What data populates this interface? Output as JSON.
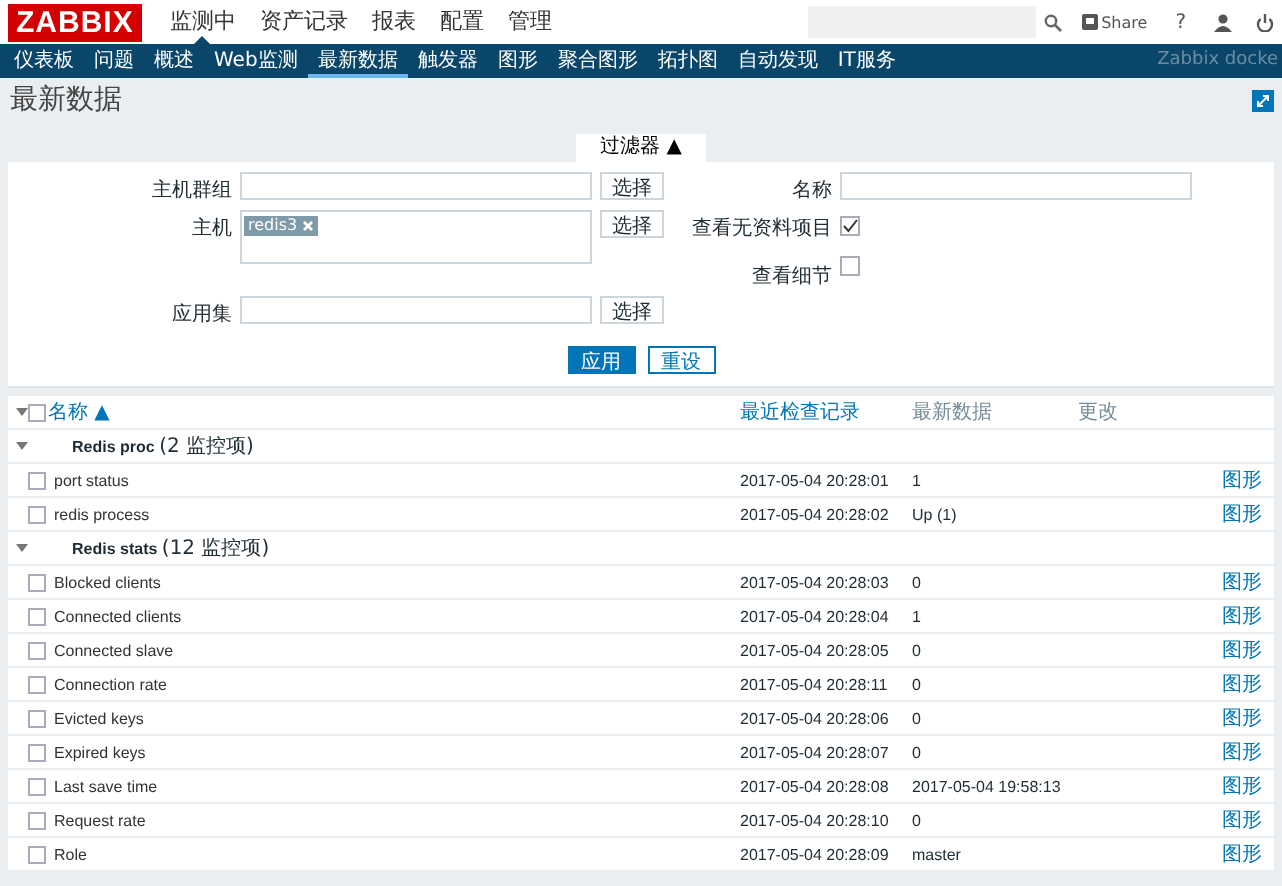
{
  "top_menu": {
    "logo": "ZABBIX",
    "items": [
      {
        "label": "监测中",
        "selected": true
      },
      {
        "label": "资产记录",
        "selected": false
      },
      {
        "label": "报表",
        "selected": false
      },
      {
        "label": "配置",
        "selected": false
      },
      {
        "label": "管理",
        "selected": false
      }
    ],
    "share": "Share",
    "help": "?"
  },
  "sub_menu": {
    "items": [
      {
        "label": "仪表板",
        "selected": false
      },
      {
        "label": "问题",
        "selected": false
      },
      {
        "label": "概述",
        "selected": false
      },
      {
        "label": "Web监测",
        "selected": false
      },
      {
        "label": "最新数据",
        "selected": true
      },
      {
        "label": "触发器",
        "selected": false
      },
      {
        "label": "图形",
        "selected": false
      },
      {
        "label": "聚合图形",
        "selected": false
      },
      {
        "label": "拓扑图",
        "selected": false
      },
      {
        "label": "自动发现",
        "selected": false
      },
      {
        "label": "IT服务",
        "selected": false
      }
    ],
    "server_name": "Zabbix docke"
  },
  "page_title": "最新数据",
  "filter": {
    "tab": "过滤器 ▲",
    "expanded": true,
    "host_group": {
      "label": "主机群组",
      "button": "选择"
    },
    "host": {
      "label": "主机",
      "tags": [
        "redis3"
      ],
      "button": "选择"
    },
    "application": {
      "label": "应用集",
      "button": "选择"
    },
    "name": {
      "label": "名称"
    },
    "show_no_data": {
      "label": "查看无资料项目",
      "checked": true
    },
    "show_details": {
      "label": "查看细节",
      "checked": false
    },
    "apply": "应用",
    "reset": "重设"
  },
  "table": {
    "all_checked": false,
    "columns": [
      "名称 ▲",
      "最近检查记录",
      "最新数据",
      "更改"
    ],
    "groups": [
      {
        "name": "Redis proc",
        "count": "(2 监控项)",
        "expanded": true,
        "rows": [
          {
            "name": "port status",
            "last_check": "2017-05-04 20:28:01",
            "last_value": "1",
            "link": "图形",
            "checked": false
          },
          {
            "name": "redis process",
            "last_check": "2017-05-04 20:28:02",
            "last_value": "Up (1)",
            "link": "图形",
            "checked": false
          }
        ]
      },
      {
        "name": "Redis stats",
        "count": "(12 监控项)",
        "expanded": true,
        "rows": [
          {
            "name": "Blocked clients",
            "last_check": "2017-05-04 20:28:03",
            "last_value": "0",
            "link": "图形",
            "checked": false
          },
          {
            "name": "Connected clients",
            "last_check": "2017-05-04 20:28:04",
            "last_value": "1",
            "link": "图形",
            "checked": false
          },
          {
            "name": "Connected slave",
            "last_check": "2017-05-04 20:28:05",
            "last_value": "0",
            "link": "图形",
            "checked": false
          },
          {
            "name": "Connection rate",
            "last_check": "2017-05-04 20:28:11",
            "last_value": "0",
            "link": "图形",
            "checked": false
          },
          {
            "name": "Evicted keys",
            "last_check": "2017-05-04 20:28:06",
            "last_value": "0",
            "link": "图形",
            "checked": false
          },
          {
            "name": "Expired keys",
            "last_check": "2017-05-04 20:28:07",
            "last_value": "0",
            "link": "图形",
            "checked": false
          },
          {
            "name": "Last save time",
            "last_check": "2017-05-04 20:28:08",
            "last_value": "2017-05-04 19:58:13",
            "link": "图形",
            "checked": false
          },
          {
            "name": "Request rate",
            "last_check": "2017-05-04 20:28:10",
            "last_value": "0",
            "link": "图形",
            "checked": false
          },
          {
            "name": "Role",
            "last_check": "2017-05-04 20:28:09",
            "last_value": "master",
            "link": "图形",
            "checked": false
          }
        ]
      }
    ]
  }
}
